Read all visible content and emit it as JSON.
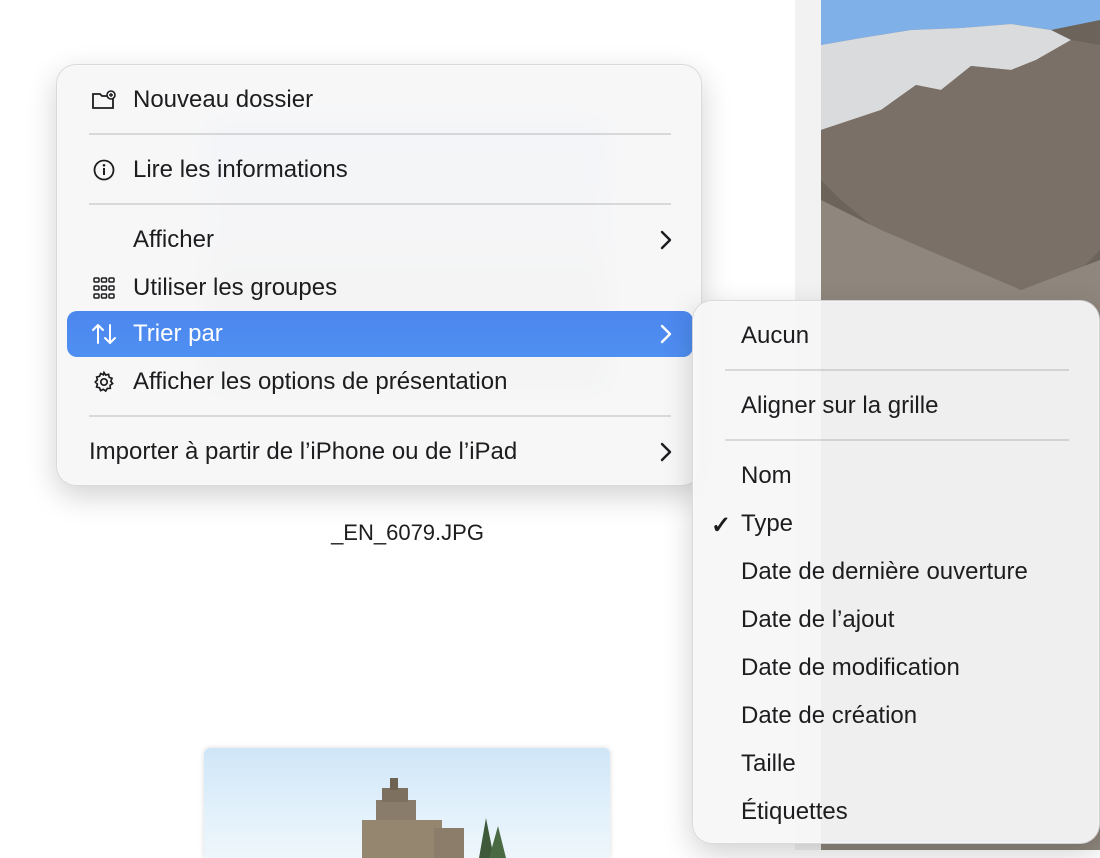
{
  "file": {
    "name": "_EN_6079.JPG"
  },
  "context_menu": {
    "items": [
      {
        "label": "Nouveau dossier",
        "icon": "new-folder-icon"
      },
      {
        "label": "Lire les informations",
        "icon": "info-icon"
      },
      {
        "label": "Afficher",
        "icon": "",
        "submenu": true
      },
      {
        "label": "Utiliser les groupes",
        "icon": "grid-icon"
      },
      {
        "label": "Trier par",
        "icon": "sort-arrows-icon",
        "submenu": true,
        "highlighted": true
      },
      {
        "label": "Afficher les options de présentation",
        "icon": "gear-icon"
      },
      {
        "label": "Importer à partir de l’iPhone ou de l’iPad",
        "icon": "",
        "submenu": true
      }
    ]
  },
  "sort_submenu": {
    "items": [
      {
        "label": "Aucun",
        "checked": false
      },
      {
        "label": "Aligner sur la grille",
        "checked": false
      },
      {
        "label": "Nom",
        "checked": false
      },
      {
        "label": "Type",
        "checked": true,
        "check_mark": "✓"
      },
      {
        "label": "Date de dernière ouverture",
        "checked": false
      },
      {
        "label": "Date de l’ajout",
        "checked": false
      },
      {
        "label": "Date de modification",
        "checked": false
      },
      {
        "label": "Date de création",
        "checked": false
      },
      {
        "label": "Taille",
        "checked": false
      },
      {
        "label": "Étiquettes",
        "checked": false
      }
    ]
  },
  "colors": {
    "highlight": "#4f8ff2",
    "menu_bg": "#f6f6f8",
    "text": "#1d1d1f"
  }
}
